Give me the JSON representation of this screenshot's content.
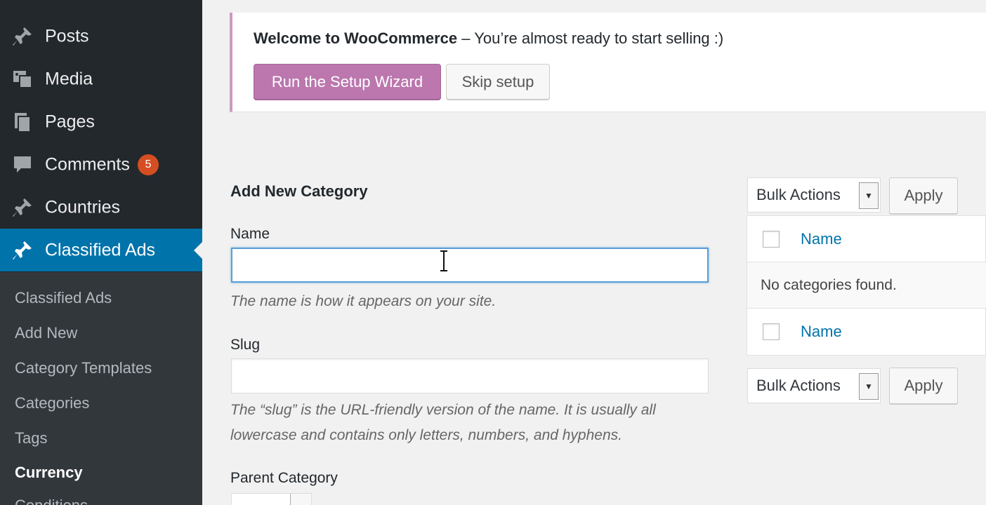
{
  "sidebar": {
    "menu": [
      {
        "label": "Posts",
        "icon": "pushpin-icon"
      },
      {
        "label": "Media",
        "icon": "media-icon"
      },
      {
        "label": "Pages",
        "icon": "pages-icon"
      },
      {
        "label": "Comments",
        "icon": "comment-icon",
        "badge": "5"
      },
      {
        "label": "Countries",
        "icon": "pushpin-icon"
      },
      {
        "label": "Classified Ads",
        "icon": "pushpin-icon",
        "active": true
      }
    ],
    "submenu": [
      "Classified Ads",
      "Add New",
      "Category Templates",
      "Categories",
      "Tags",
      "Currency",
      "Conditions"
    ],
    "current_submenu": "Currency"
  },
  "notice": {
    "title": "Welcome to WooCommerce",
    "dash": " – ",
    "message": "You’re almost ready to start selling :)",
    "wizard_button": "Run the Setup Wizard",
    "skip_button": "Skip setup"
  },
  "form": {
    "heading": "Add New Category",
    "name_label": "Name",
    "name_value": "",
    "name_desc": "The name is how it appears on your site.",
    "slug_label": "Slug",
    "slug_value": "",
    "slug_desc_1": "The “slug” is the URL-friendly version of the name. It is usually all",
    "slug_desc_2": "lowercase and contains only letters, numbers, and hyphens.",
    "parent_label": "Parent Category"
  },
  "list": {
    "bulk_actions": "Bulk Actions",
    "apply": "Apply",
    "column_name": "Name",
    "empty_message": "No categories found."
  },
  "colors": {
    "sidebar_bg": "#23282d",
    "active_bg": "#0073aa",
    "woo_purple": "#bb77ae",
    "badge": "#d54e21",
    "link": "#0073aa"
  }
}
